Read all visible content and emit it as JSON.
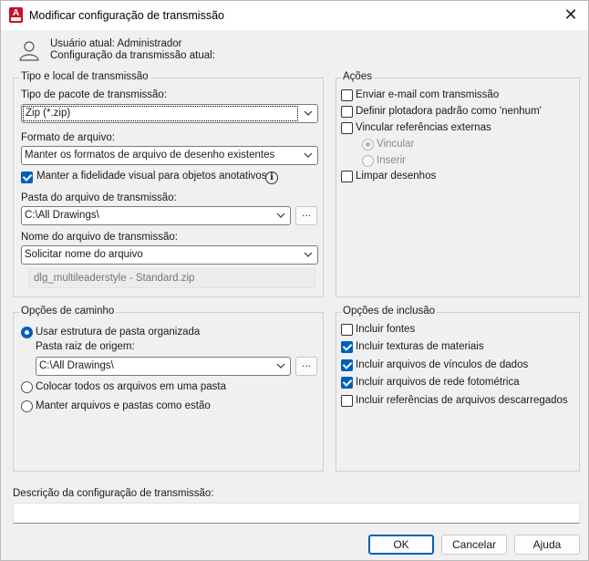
{
  "window": {
    "title": "Modificar configuração de transmissão"
  },
  "header": {
    "current_user": "Usuário atual: Administrador",
    "current_config": "Configuração da transmissão atual:"
  },
  "transmittal": {
    "group_title": "Tipo e local de transmissão",
    "package_type_label": "Tipo de pacote de transmissão:",
    "package_type_value": "Zip (*.zip)",
    "file_format_label": "Formato de arquivo:",
    "file_format_value": "Manter os formatos de arquivo de desenho existentes",
    "visual_fidelity_label": "Manter a fidelidade visual para objetos anotativos",
    "folder_label": "Pasta do arquivo de transmissão:",
    "folder_value": "C:\\All Drawings\\",
    "browse_label": "...",
    "filename_label": "Nome do arquivo de transmissão:",
    "filename_value": "Solicitar nome do arquivo",
    "filename_preview": "dlg_multileaderstyle - Standard.zip"
  },
  "actions": {
    "group_title": "Ações",
    "send_email": "Enviar e-mail com transmissão",
    "set_plotter": "Definir plotadora padrão como 'nenhum'",
    "bind_xrefs": "Vincular referências externas",
    "bind": "Vincular",
    "insert": "Inserir",
    "purge": "Limpar desenhos"
  },
  "path_options": {
    "group_title": "Opções de caminho",
    "organized": "Usar estrutura de pasta organizada",
    "source_root_label": "Pasta raiz de origem:",
    "source_root_value": "C:\\All Drawings\\",
    "browse_label": "...",
    "single_folder": "Colocar todos os arquivos em uma pasta",
    "keep_as_is": "Manter arquivos e pastas como estão"
  },
  "include_options": {
    "group_title": "Opções de inclusão",
    "fonts": "Incluir fontes",
    "material_textures": "Incluir texturas de materiais",
    "data_links": "Incluir arquivos de vínculos de dados",
    "photometric": "Incluir arquivos de rede fotométrica",
    "unloaded_refs": "Incluir referências de arquivos descarregados"
  },
  "description": {
    "label": "Descrição da configuração de transmissão:",
    "value": ""
  },
  "buttons": {
    "ok": "OK",
    "cancel": "Cancelar",
    "help": "Ajuda"
  },
  "colors": {
    "accent": "#005fb8",
    "app_icon": "#c8102e"
  },
  "icons": {
    "app": "autocad-icon",
    "user": "user-icon",
    "info": "info-icon",
    "close": "close-icon",
    "dropdown": "chevron-down-icon"
  }
}
